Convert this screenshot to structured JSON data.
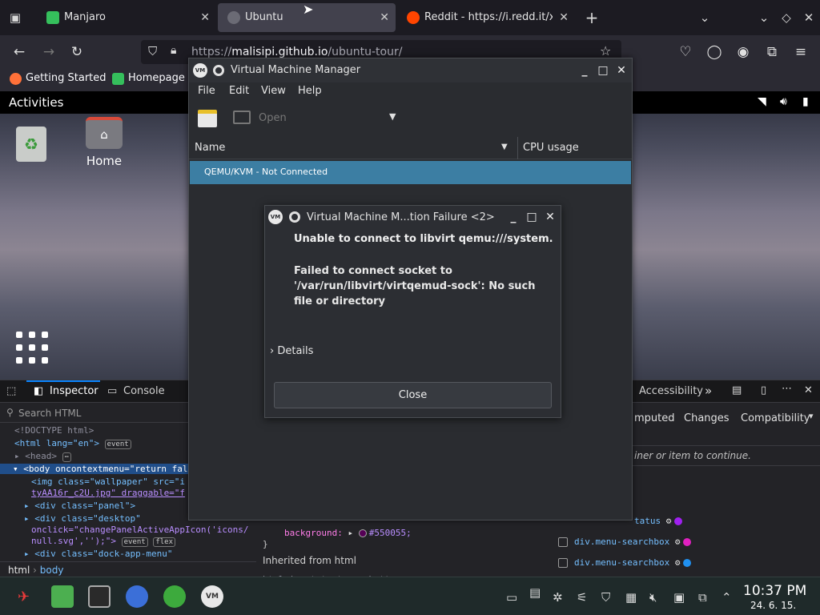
{
  "browser": {
    "tabs": [
      {
        "label": "Manjaro",
        "active": false
      },
      {
        "label": "Ubuntu",
        "active": true
      },
      {
        "label": "Reddit - https://i.redd.it/x",
        "active": false
      }
    ],
    "url_prefix": "https://",
    "url_host": "malisipi.github.io",
    "url_path": "/ubuntu-tour/",
    "bookmarks": [
      "Getting Started",
      "Homepage"
    ]
  },
  "gnome": {
    "activities": "Activities",
    "desktop_icons": [
      {
        "label": ""
      },
      {
        "label": "Home"
      }
    ]
  },
  "devtools": {
    "tabs": [
      "Inspector",
      "Console"
    ],
    "right_tabs": [
      "Accessibility"
    ],
    "side_tabs": [
      "mputed",
      "Changes",
      "Compatibility"
    ],
    "search_placeholder": "Search HTML",
    "lines": [
      "<!DOCTYPE html>",
      "<html lang=\"en\">",
      "<head>",
      "<body oncontextmenu=\"return fal",
      "<img class=\"wallpaper\" src=\"i",
      "tyAA16r_c2U.jpg\" draggable=\"f",
      "<div class=\"panel\">",
      "<div class=\"desktop\"",
      "onclick=\"changePanelActiveAppIcon('icons/",
      "null.svg','');\">",
      "<div class=\"dock-app-menu\""
    ],
    "badge_event": "event",
    "badge_flex": "flex",
    "css_background": "background:",
    "css_color": "#550055;",
    "inherited": "Inherited from html",
    "hint": "iner or item to continue.",
    "rules": [
      "tatus",
      "div.menu-searchbox",
      "div.menu-searchbox"
    ],
    "breadcrumb": [
      "html",
      "body"
    ],
    "footer_partial": "html  input  textarea  button"
  },
  "vmm": {
    "title": "Virtual Machine Manager",
    "menu": [
      "File",
      "Edit",
      "View",
      "Help"
    ],
    "open_label": "Open",
    "col_name": "Name",
    "col_cpu": "CPU usage",
    "row": "QEMU/KVM - Not Connected"
  },
  "dialog": {
    "title": "Virtual Machine M...tion Failure <2>",
    "heading": "Unable to connect to libvirt qemu:///system.",
    "message": "Failed to connect socket to '/var/run/libvirt/virtqemud-sock': No such file or directory",
    "details": "Details",
    "close": "Close"
  },
  "taskbar": {
    "time": "10:37 PM",
    "date": "24. 6. 15."
  },
  "colors": {
    "selection": "#3c7ea3",
    "devtools_accent": "#0a84ff"
  }
}
